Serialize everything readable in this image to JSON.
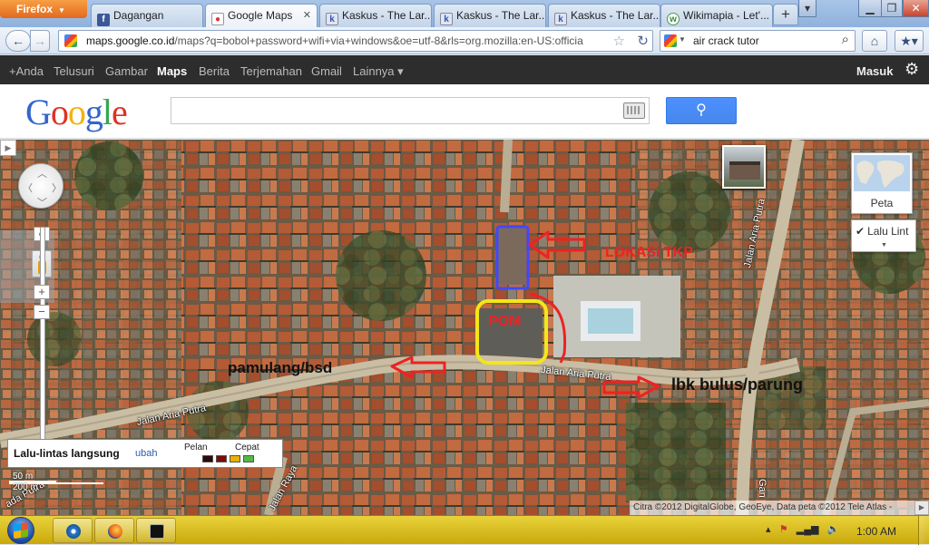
{
  "browser": {
    "app_button": "Firefox",
    "tabs": [
      {
        "title": "Dagangan",
        "favicon": "facebook-icon"
      },
      {
        "title": "Google Maps",
        "favicon": "google-maps-icon"
      },
      {
        "title": "Kaskus - The Lar...",
        "favicon": "kaskus-icon"
      },
      {
        "title": "Kaskus - The Lar...",
        "favicon": "kaskus-icon"
      },
      {
        "title": "Kaskus - The Lar...",
        "favicon": "kaskus-icon"
      },
      {
        "title": "Wikimapia - Let'...",
        "favicon": "wikimapia-icon"
      }
    ],
    "active_tab": 1,
    "new_tab": "+",
    "url_host": "maps.google.co.id",
    "url_rest": "/maps?q=bobol+password+wifi+via+windows&oe=utf-8&rls=org.mozilla:en-US:officia",
    "search_query": "air crack tutor"
  },
  "google_bar": {
    "items": [
      "+Anda",
      "Telusuri",
      "Gambar",
      "Maps",
      "Berita",
      "Terjemahan",
      "Gmail",
      "Lainnya ▾"
    ],
    "selected": "Maps",
    "signin": "Masuk"
  },
  "header": {
    "logo": [
      "G",
      "o",
      "o",
      "g",
      "l",
      "e"
    ],
    "logo_colors": [
      "#3366cc",
      "#dd3322",
      "#f2b30f",
      "#3366cc",
      "#33a852",
      "#dd3322"
    ],
    "search_value": "",
    "accent": "#4d90fe"
  },
  "map": {
    "annotations": {
      "lokasi": "LOKASI TKP",
      "pom": "POM",
      "west": "pamulang/bsd",
      "east": "lbk bulus/parung"
    },
    "roads": {
      "aria_putra_left": "Jalan Aria Putra",
      "aria_putra_mid": "Jalan Aria Putra",
      "aria_putra_right": "Jalan Aria Putra",
      "bottom_left": "ada Putra",
      "bottom_mid": "Jalan Raya",
      "bottom_right": "Gan"
    },
    "controls": {
      "map_type": "Peta",
      "traffic_toggle": "Lalu Lint",
      "zoom_in": "+",
      "zoom_out": "−"
    },
    "legend": {
      "title": "Lalu-lintas langsung",
      "change": "ubah",
      "slow": "Pelan",
      "fast": "Cepat",
      "colors": [
        "#2b0a0a",
        "#7a0c0c",
        "#e8b000",
        "#54b848"
      ]
    },
    "scale": {
      "top": "50 m",
      "bottom": "200 m"
    },
    "copyright": "Citra ©2012 DigitalGlobe, GeoEye, Data peta ©2012 Tele Atlas -"
  },
  "taskbar": {
    "clock": "1:00 AM",
    "apps": [
      "media-center-icon",
      "firefox-icon",
      "command-prompt-icon"
    ]
  }
}
